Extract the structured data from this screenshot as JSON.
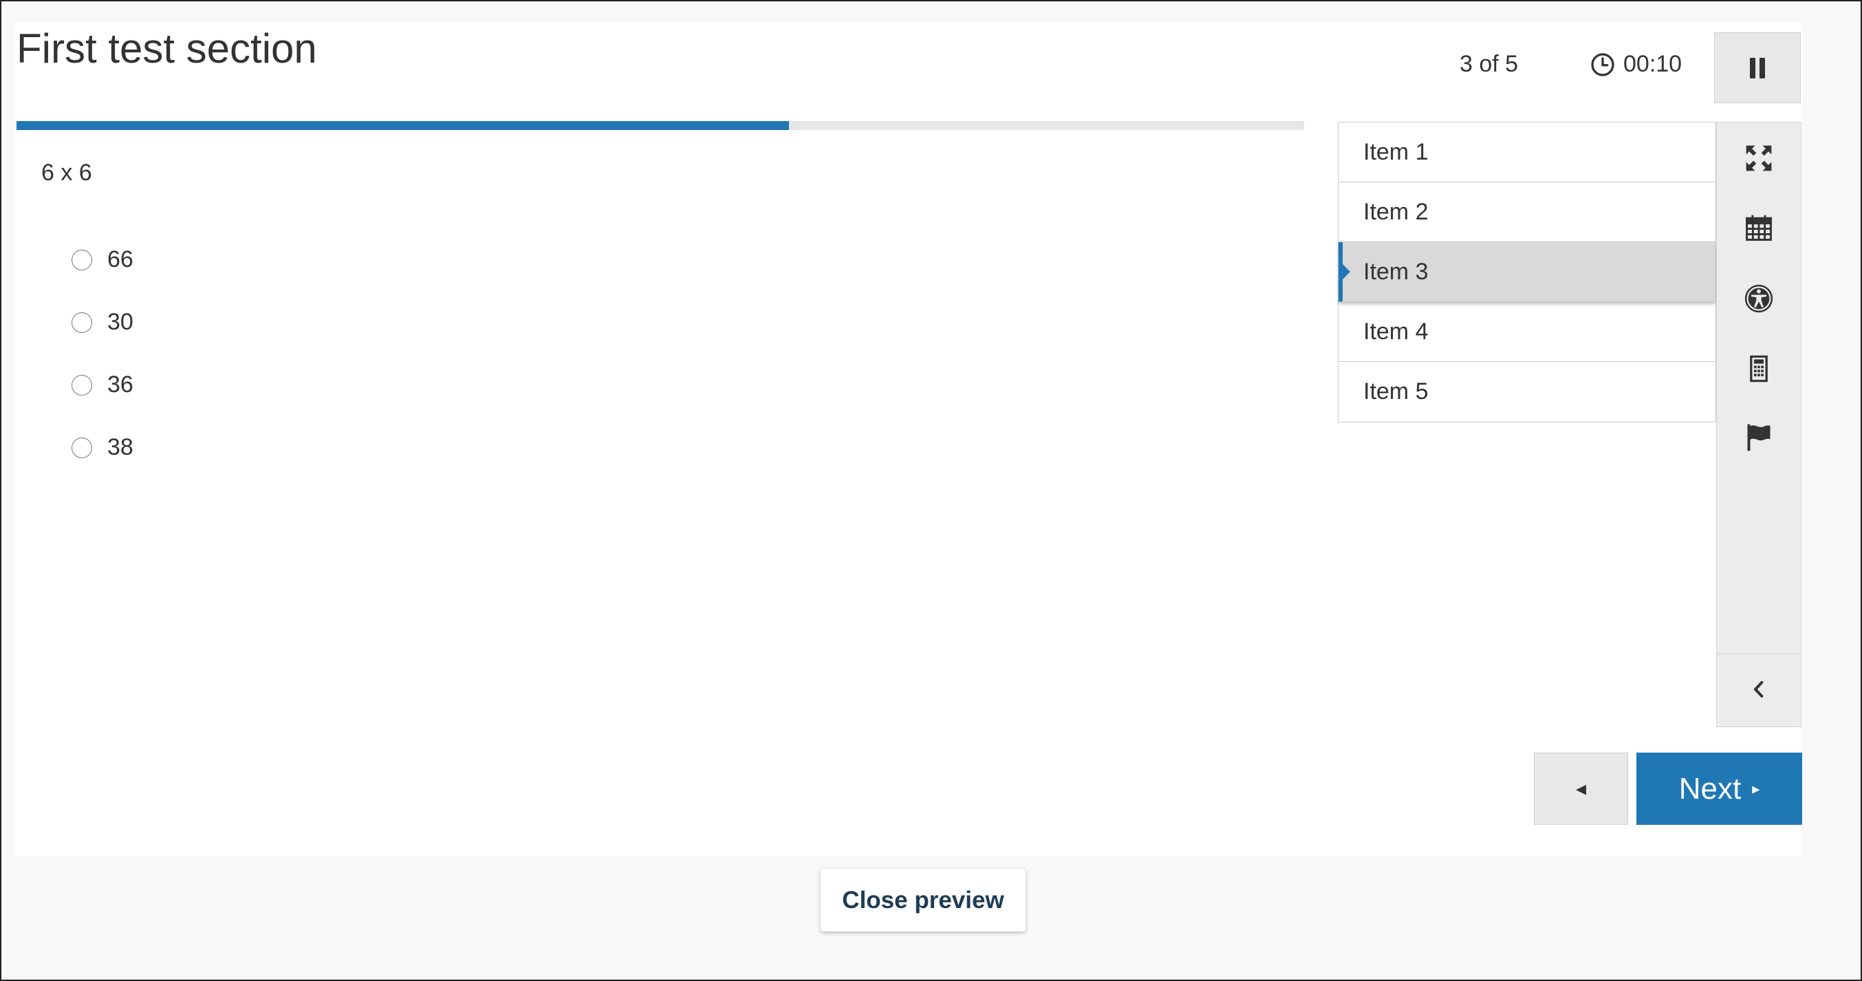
{
  "section_title": "First test section",
  "counter": "3 of 5",
  "timer": {
    "icon": "clock-icon",
    "value": "00:10"
  },
  "pause_icon": "pause-icon",
  "progress": {
    "fraction": 0.6
  },
  "question": {
    "prompt": "6 x 6",
    "choices": [
      "66",
      "30",
      "36",
      "38"
    ]
  },
  "item_list": {
    "items": [
      "Item 1",
      "Item 2",
      "Item 3",
      "Item 4",
      "Item 5"
    ],
    "active_index": 2
  },
  "tools": [
    "fullscreen-icon",
    "calendar-icon",
    "accessibility-icon",
    "calculator-icon",
    "flag-icon"
  ],
  "collapse_icon": "chevron-left-icon",
  "nav": {
    "prev_symbol": "◂",
    "next_label": "Next",
    "next_symbol": "▸"
  },
  "close_label": "Close preview",
  "colors": {
    "accent": "#1f78b4",
    "close_text": "#1e3b54",
    "active_item_bg": "#d9d9d9"
  }
}
